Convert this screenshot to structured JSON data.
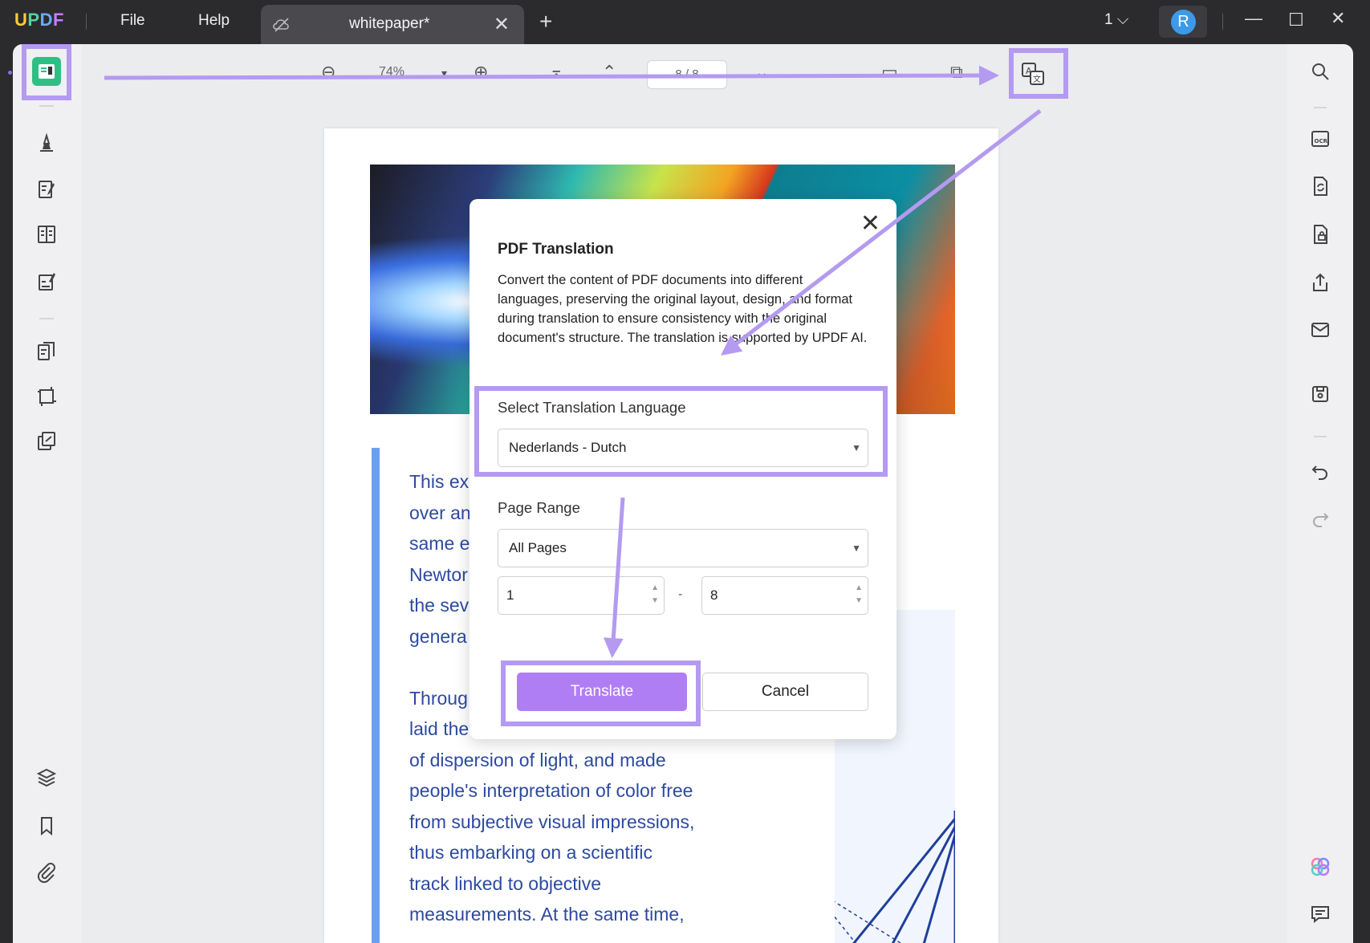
{
  "app": {
    "logo_u": "U",
    "logo_p": "P",
    "logo_d": "D",
    "logo_f": "F",
    "menu": [
      "File",
      "Help"
    ],
    "tab_title": "whitepaper*",
    "tab_close": "✕",
    "new_tab": "+",
    "page_indicator": "1",
    "avatar_letter": "R"
  },
  "toolbar": {
    "zoom_value": "74%",
    "page_field": "8 / 8"
  },
  "document": {
    "lines": [
      "This ex",
      "over an",
      "same e",
      "Newtor",
      "the sev",
      "genera",
      "Throug",
      "laid the",
      "of dispersion of light, and made",
      "people's interpretation of color free",
      "from subjective visual impressions,",
      "thus embarking on a scientific",
      "track linked to objective",
      "measurements. At the same time,"
    ]
  },
  "dialog": {
    "title": "PDF Translation",
    "description": "Convert the content of PDF documents into different languages, preserving the original layout, design, and format during translation to ensure consistency with the original document's structure. The translation is supported by UPDF AI.",
    "language_label": "Select Translation Language",
    "language_value": "Nederlands - Dutch",
    "page_range_label": "Page Range",
    "page_range_value": "All Pages",
    "range_from": "1",
    "range_to": "8",
    "range_dash": "-",
    "translate_button": "Translate",
    "cancel_button": "Cancel",
    "close": "✕"
  },
  "colors": {
    "accent": "#b07ef4",
    "highlight": "#b49af0",
    "text_blue": "#2d4aa0"
  }
}
